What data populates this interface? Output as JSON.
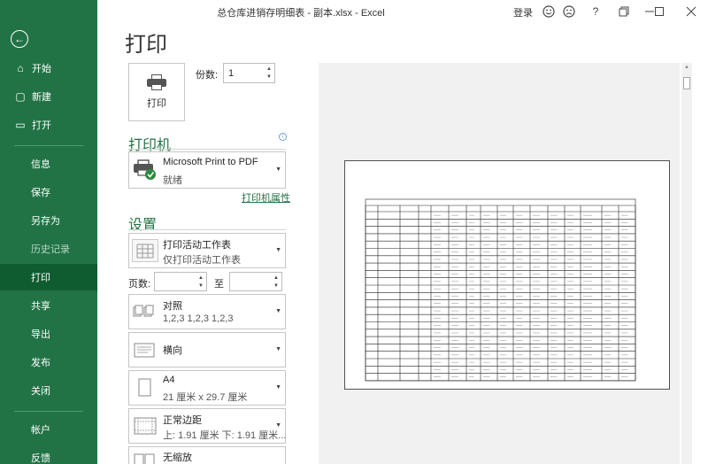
{
  "window": {
    "title": "总仓库进销存明细表 - 副本.xlsx  -  Excel",
    "login_label": "登录",
    "icons": [
      "smiley-icon",
      "frown-icon",
      "help-icon",
      "restore-icon",
      "minimize-icon",
      "maximize-icon",
      "close-icon"
    ],
    "help_glyph": "?"
  },
  "sidebar": {
    "back_icon": "back-arrow-icon",
    "items": [
      {
        "label": "开始",
        "icon": "home-icon",
        "glyph": "⌂"
      },
      {
        "label": "新建",
        "icon": "new-file-icon",
        "glyph": "▢"
      },
      {
        "label": "打开",
        "icon": "open-folder-icon",
        "glyph": "▭"
      },
      {
        "label": "信息"
      },
      {
        "label": "保存"
      },
      {
        "label": "另存为"
      },
      {
        "label": "历史记录"
      },
      {
        "label": "打印"
      },
      {
        "label": "共享"
      },
      {
        "label": "导出"
      },
      {
        "label": "发布"
      },
      {
        "label": "关闭"
      },
      {
        "label": "帐户"
      },
      {
        "label": "反馈"
      }
    ],
    "active": "打印",
    "disabled": "历史记录"
  },
  "page_title": "打印",
  "print_button_label": "打印",
  "copies": {
    "label": "份数:",
    "value": "1"
  },
  "printer": {
    "section_title": "打印机",
    "name": "Microsoft Print to PDF",
    "status": "就绪",
    "properties_link": "打印机属性",
    "info_icon": "i"
  },
  "settings": {
    "section_title": "设置",
    "print_what": {
      "title": "打印活动工作表",
      "subtitle": "仅打印活动工作表"
    },
    "pages_label": "页数:",
    "to_label": "至",
    "collate": {
      "title": "对照",
      "subtitle": "1,2,3    1,2,3    1,2,3"
    },
    "orientation": {
      "title": "横向"
    },
    "paper": {
      "title": "A4",
      "subtitle": "21 厘米 x 29.7 厘米"
    },
    "margins": {
      "title": "正常边距",
      "subtitle": "上: 1.91 厘米 下: 1.91 厘米..."
    },
    "scaling": {
      "title": "无缩放"
    }
  },
  "colors": {
    "excel_green": "#217346",
    "sidebar_active": "#0e5c2f",
    "preview_bg": "#f1f1f1"
  }
}
